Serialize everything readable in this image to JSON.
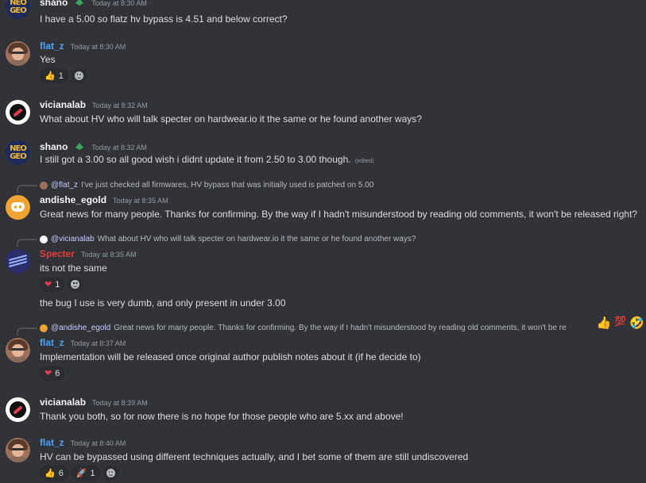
{
  "messages": [
    {
      "user": "shano",
      "time": "Today at 8:30 AM",
      "text": "I have a 5.00 so flatz hv bypass is 4.51 and below correct?"
    },
    {
      "user": "flat_z",
      "time": "Today at 8:30 AM",
      "text": "Yes",
      "reactions": [
        {
          "icon": "thumbs-up",
          "count": "1"
        }
      ]
    },
    {
      "user": "vicianalab",
      "time": "Today at 8:32 AM",
      "text": "What about HV who will talk specter on hardwear.io it the same or he found another ways?"
    },
    {
      "user": "shano",
      "time": "Today at 8:32 AM",
      "text": "I still got a 3.00 so all good wish i didnt update it from 2.50 to 3.00 though.",
      "edited": "(edited)"
    },
    {
      "user": "andishe_egold",
      "time": "Today at 8:35 AM",
      "reply_mention": "@flat_z",
      "reply_text": "I've just checked all firmwares, HV bypass that was initially used is patched on 5.00",
      "text": "Great news for many people. Thanks for confirming. By the way if I hadn't misunderstood by reading old comments, it won't be released right?"
    },
    {
      "user": "Specter",
      "time": "Today at 8:35 AM",
      "reply_mention": "@vicianalab",
      "reply_text": "What about HV who will talk specter on hardwear.io it the same or he found another ways?",
      "text": "its not the same",
      "reactions": [
        {
          "icon": "heart",
          "count": "1"
        }
      ],
      "text2": "the bug I use is very dumb, and only present in under 3.00"
    },
    {
      "user": "flat_z",
      "time": "Today at 8:37 AM",
      "reply_mention": "@andishe_egold",
      "reply_text": "Great news for many people. Thanks for confirming. By the way if I hadn't misunderstood by reading old comments, it won't be re",
      "text": "Implementation will be released once original author publish notes about it (if he decide to)",
      "reactions": [
        {
          "icon": "heart",
          "count": "6"
        }
      ]
    },
    {
      "user": "vicianalab",
      "time": "Today at 8:39 AM",
      "text": "Thank you both, so for now there is no hope for those people who are 5.xx and above!"
    },
    {
      "user": "flat_z",
      "time": "Today at 8:40 AM",
      "text": "HV can be bypassed using different techniques actually, and I bet some of them are still undiscovered",
      "reactions": [
        {
          "icon": "thumbs-up",
          "count": "6"
        },
        {
          "icon": "rocket",
          "count": "1"
        }
      ]
    }
  ],
  "hover_reactions": [
    "thumbs-up",
    "hundred",
    "laughing"
  ],
  "colors": {
    "background": "#313338",
    "specter_name": "#e33d3d",
    "flatz_name": "#4aa3ff",
    "default_name": "#f2f3f5"
  }
}
